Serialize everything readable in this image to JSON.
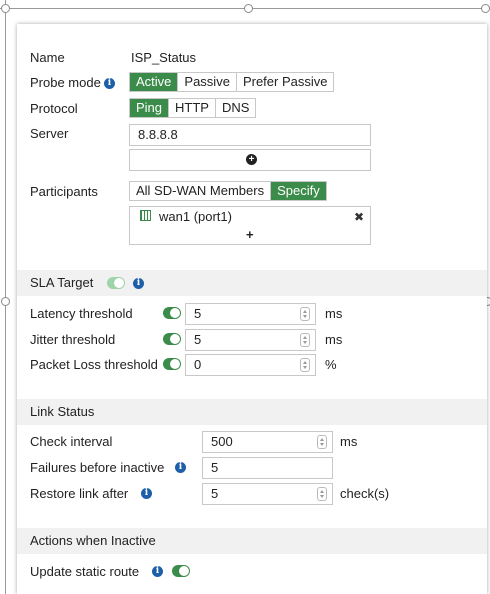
{
  "form": {
    "name_label": "Name",
    "name_value": "ISP_Status",
    "probe_mode_label": "Probe mode",
    "probe_modes": [
      "Active",
      "Passive",
      "Prefer Passive"
    ],
    "protocol_label": "Protocol",
    "protocols": [
      "Ping",
      "HTTP",
      "DNS"
    ],
    "server_label": "Server",
    "server_value": "8.8.8.8",
    "participants_label": "Participants",
    "participant_modes": [
      "All SD-WAN Members",
      "Specify"
    ],
    "participant_member": "wan1 (port1)",
    "add_symbol": "+",
    "remove_symbol": "✖"
  },
  "sla_target": {
    "title": "SLA Target",
    "latency_label": "Latency threshold",
    "latency_value": "5",
    "latency_unit": "ms",
    "jitter_label": "Jitter threshold",
    "jitter_value": "5",
    "jitter_unit": "ms",
    "packet_loss_label": "Packet Loss threshold",
    "packet_loss_value": "0",
    "packet_loss_unit": "%"
  },
  "link_status": {
    "title": "Link Status",
    "check_interval_label": "Check interval",
    "check_interval_value": "500",
    "check_interval_unit": "ms",
    "failures_label": "Failures before inactive",
    "failures_value": "5",
    "restore_label": "Restore link after",
    "restore_value": "5",
    "restore_unit": "check(s)"
  },
  "actions": {
    "title": "Actions when Inactive",
    "update_route_label": "Update static route"
  },
  "colors": {
    "accent_green": "#3b8c4a",
    "info_blue": "#1d5fa8"
  }
}
